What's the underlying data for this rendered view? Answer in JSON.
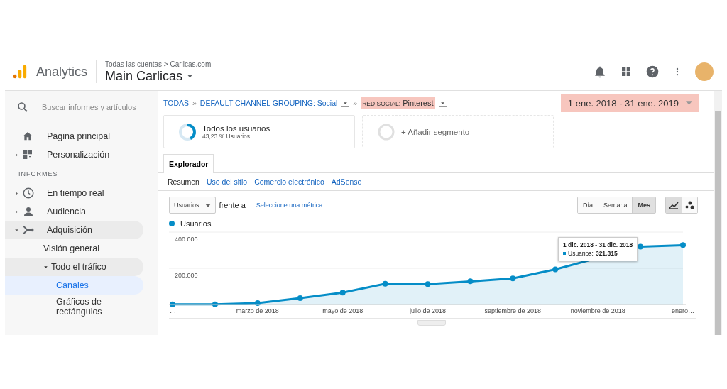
{
  "header": {
    "product": "Analytics",
    "breadcrumb": "Todas las cuentas > Carlicas.com",
    "view": "Main Carlicas"
  },
  "sidebar": {
    "search": {
      "placeholder": "Buscar informes y artículos"
    },
    "items": [
      {
        "label": "Página principal",
        "selected": false
      },
      {
        "label": "Personalización",
        "expanded": false,
        "selected": false
      }
    ],
    "section": "INFORMES",
    "reports": [
      {
        "label": "En tiempo real",
        "expanded": false,
        "selected": false
      },
      {
        "label": "Audiencia",
        "expanded": false,
        "selected": false
      },
      {
        "label": "Adquisición",
        "expanded": true,
        "selected": false,
        "children": [
          {
            "label": "Visión general",
            "selected": false
          },
          {
            "label": "Todo el tráfico",
            "expanded": true,
            "selected": false,
            "children": [
              {
                "label": "Canales",
                "selected": true
              },
              {
                "label": "Gráficos de rectángulos",
                "selected": false
              }
            ]
          }
        ]
      }
    ]
  },
  "breadcrumb": [
    {
      "label": "TODAS",
      "kind": "link"
    },
    {
      "separator": "»",
      "label": "DEFAULT CHANNEL GROUPING: Social",
      "kind": "dropdown"
    },
    {
      "separator": "»",
      "label": "RED SOCIAL:",
      "value": "Pinterest",
      "kind": "chip",
      "highlighted": true
    }
  ],
  "date_range": {
    "label": "1 ene. 2018 - 31 ene. 2019",
    "highlighted": true
  },
  "segments": [
    {
      "kind": "active",
      "title": "Todos los usuarios",
      "subtitle": "43,23 % Usuarios",
      "level": 0.4323
    },
    {
      "kind": "add",
      "title": "+ Añadir segmento"
    }
  ],
  "tabs": [
    {
      "label": "Explorador",
      "selected": true
    }
  ],
  "subtabs": [
    {
      "label": "Resumen",
      "selected": true
    },
    {
      "label": "Uso del sitio",
      "selected": false
    },
    {
      "label": "Comercio electrónico",
      "selected": false
    },
    {
      "label": "AdSense",
      "selected": false
    }
  ],
  "metric": {
    "value": "Usuarios",
    "versus": "frente a",
    "link": "Seleccione una métrica"
  },
  "granularity": [
    {
      "label": "Día",
      "selected": false
    },
    {
      "label": "Semana",
      "selected": false
    },
    {
      "label": "Mes",
      "selected": true
    }
  ],
  "chart_types": [
    {
      "kind": "line",
      "selected": true
    },
    {
      "kind": "motion",
      "selected": false
    }
  ],
  "chart": {
    "tooltip": {
      "title": "1 dic. 2018 - 31 dic. 2018",
      "text": "Usuarios: **321.315**"
    },
    "chart_data": {
      "type": "area",
      "categories": [
        "…",
        null,
        "marzo de 2018",
        null,
        "mayo de 2018",
        null,
        "julio de 2018",
        null,
        "septiembre de 2018",
        null,
        "noviembre de 2018",
        null,
        "enero…"
      ],
      "series": [
        {
          "name": "Usuarios",
          "color": "#058dc7",
          "values": [
            1000,
            1000,
            8000,
            35000,
            66000,
            115000,
            113000,
            128000,
            144000,
            194000,
            null,
            320000,
            328000
          ]
        }
      ],
      "ylim": [
        0,
        400000
      ],
      "yticks": [
        {
          "value": 200000,
          "label": "200.000"
        },
        {
          "value": 400000,
          "label": "400.000"
        }
      ]
    }
  }
}
